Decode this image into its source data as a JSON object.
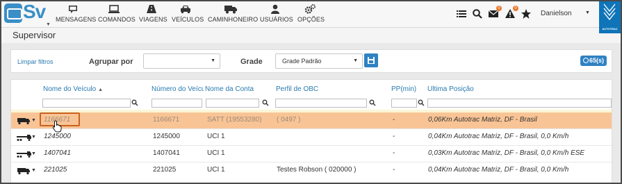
{
  "logo": {
    "text": "Sv"
  },
  "nav": [
    {
      "label": "MENSAGENS",
      "icon": "message-icon"
    },
    {
      "label": "COMANDOS",
      "icon": "monitor-icon"
    },
    {
      "label": "VIAGENS",
      "icon": "road-icon"
    },
    {
      "label": "VEÍCULOS",
      "icon": "car-icon"
    },
    {
      "label": "CAMINHONEIRO",
      "icon": "truck-icon"
    },
    {
      "label": "USUÁRIOS",
      "icon": "user-icon"
    },
    {
      "label": "OPÇÕES",
      "icon": "gears-icon"
    }
  ],
  "toolbar": {
    "mail_badge": "0",
    "alert_badge": "0"
  },
  "user": {
    "name": "Danielson"
  },
  "brand": {
    "tag": "AUTOTRAC",
    "color": "#0f74b8"
  },
  "page": {
    "title": "Supervisor"
  },
  "filters": {
    "clear_label": "Limpar filtros",
    "group_by_label": "Agrupar por",
    "group_by_value": "",
    "grid_label": "Grade",
    "grid_value": "Grade Padrão",
    "count": "65(s)"
  },
  "columns": [
    "Nome do Veículo",
    "Número do Veículo",
    "Nome da Conta",
    "Perfil de OBC",
    "PP(min)",
    "Última Posição"
  ],
  "rows": [
    {
      "name": "1166671",
      "number": "1166671",
      "account": "SATT (19553280)",
      "profile": "( 0497 )",
      "pp": "-",
      "position": "0,06Km Autotrac Matriz, DF - Brasil",
      "selected": true
    },
    {
      "name": "1245000",
      "number": "1245000",
      "account": "UCI 1",
      "profile": "",
      "pp": "-",
      "position": "0,04Km Autotrac Matriz, DF - Brasil, 0,0 Km/h",
      "selected": false
    },
    {
      "name": "1407041",
      "number": "1407041",
      "account": "UCI 1",
      "profile": "",
      "pp": "-",
      "position": "0,03Km Autotrac Matriz, DF - Brasil, 0,0 Km/h ESE",
      "selected": false
    },
    {
      "name": "221025",
      "number": "221025",
      "account": "UCI 1",
      "profile": "Testes Robson ( 020000 )",
      "pp": "-",
      "position": "0,04Km Autotrac Matriz, DF - Brasil, 0,0 Km/h",
      "selected": false
    }
  ],
  "colors": {
    "accent": "#2f82c3",
    "selection": "#f9c495",
    "highlight_border": "#c8621f"
  }
}
